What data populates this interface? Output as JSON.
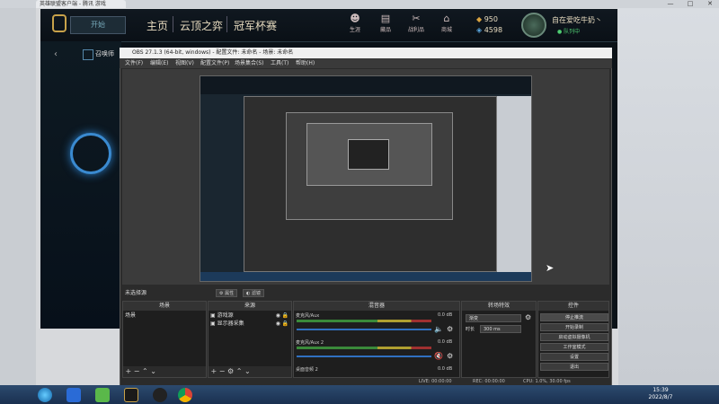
{
  "browser": {
    "tab_title": "英雄联盟客户端 - 腾讯 游戏",
    "win_min": "—",
    "win_max": "□",
    "win_close": "✕"
  },
  "lol": {
    "play_label": "开始",
    "nav": [
      "主页",
      "云顶之弈",
      "冠军杯赛"
    ],
    "shop": [
      "生涯",
      "藏品",
      "战利品",
      "商城"
    ],
    "blue_essence": "950",
    "rp": "4598",
    "username": "自在爱吃牛奶丶",
    "status": "● 队列中",
    "summon_label": "召唤师",
    "back": "‹"
  },
  "obs": {
    "title": "OBS 27.1.3 (64-bit, windows) - 配置文件: 未命名 - 场景: 未命名",
    "menus": [
      "文件(F)",
      "编辑(E)",
      "视图(V)",
      "配置文件(P)",
      "场景集合(S)",
      "工具(T)",
      "帮助(H)"
    ],
    "no_source": "未选择源",
    "props_btn": "属性",
    "filter_btn": "滤镜",
    "docks": {
      "scenes": {
        "title": "场景",
        "items": [
          "场景"
        ]
      },
      "sources": {
        "title": "来源",
        "items": [
          "游戏源",
          "显示器采集"
        ]
      },
      "mixer": {
        "title": "混音器",
        "ch1": "麦克风/Aux",
        "ch1_db": "0.0 dB",
        "ch2": "麦克风/Aux 2",
        "ch2_db": "0.0 dB",
        "ch3": "桌面音频 2",
        "ch3_db": "0.0 dB"
      },
      "transitions": {
        "title": "转场特效",
        "type": "渐变",
        "duration_label": "时长",
        "duration": "300 ms"
      },
      "controls": {
        "title": "控件",
        "buttons": [
          "停止推流",
          "开始录制",
          "启动虚拟摄像机",
          "工作室模式",
          "设置",
          "退出"
        ]
      }
    },
    "status": {
      "live": "LIVE: 00:00:00",
      "rec": "REC: 00:00:00",
      "cpu": "CPU: 1.0%, 30.00 fps"
    }
  },
  "taskbar": {
    "time": "15:39",
    "date": "2022/8/7"
  }
}
